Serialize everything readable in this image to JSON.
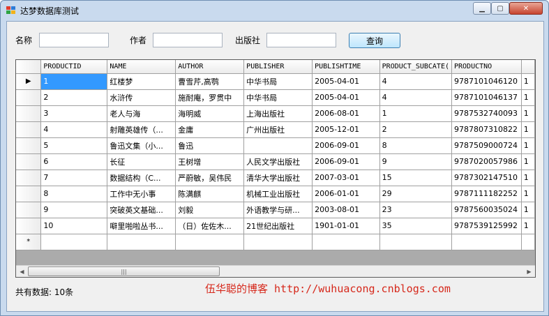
{
  "window": {
    "title": "达梦数据库测试",
    "minimize_glyph": "▁",
    "maximize_glyph": "▢",
    "close_glyph": "✕"
  },
  "filters": {
    "name_label": "名称",
    "name_value": "",
    "author_label": "作者",
    "author_value": "",
    "publisher_label": "出版社",
    "publisher_value": "",
    "query_button": "查询"
  },
  "grid": {
    "columns": [
      "PRODUCTID",
      "NAME",
      "AUTHOR",
      "PUBLISHER",
      "PUBLISHTIME",
      "PRODUCT_SUBCATE(",
      "PRODUCTNO",
      ""
    ],
    "current_row_glyph": "▶",
    "new_row_glyph": "*",
    "rows": [
      [
        "1",
        "红楼梦",
        "曹雪芹,高鹗",
        "中华书局",
        "2005-04-01",
        "4",
        "9787101046120",
        "1"
      ],
      [
        "2",
        "水浒传",
        "施耐庵，罗贯中",
        "中华书局",
        "2005-04-01",
        "4",
        "9787101046137",
        "1"
      ],
      [
        "3",
        "老人与海",
        "海明威",
        "上海出版社",
        "2006-08-01",
        "1",
        "9787532740093",
        "1"
      ],
      [
        "4",
        "射雕英雄传（...",
        "金庸",
        "广州出版社",
        "2005-12-01",
        "2",
        "9787807310822",
        "1"
      ],
      [
        "5",
        "鲁迅文集（小...",
        "鲁迅",
        "",
        "2006-09-01",
        "8",
        "9787509000724",
        "1"
      ],
      [
        "6",
        "长征",
        "王树增",
        "人民文学出版社",
        "2006-09-01",
        "9",
        "9787020057986",
        "1"
      ],
      [
        "7",
        "数据结构（C...",
        "严蔚敏，吴伟民",
        "清华大学出版社",
        "2007-03-01",
        "15",
        "9787302147510",
        "1"
      ],
      [
        "8",
        "工作中无小事",
        "陈满麒",
        "机械工业出版社",
        "2006-01-01",
        "29",
        "9787111182252",
        "1"
      ],
      [
        "9",
        "突破英文基础...",
        "刘毅",
        "外语教学与研...",
        "2003-08-01",
        "23",
        "9787560035024",
        "1"
      ],
      [
        "10",
        "噼里啪啦丛书...",
        "（日）佐佐木...",
        "21世纪出版社",
        "1901-01-01",
        "35",
        "9787539125992",
        "1"
      ]
    ],
    "scroll_left_glyph": "◀",
    "scroll_right_glyph": "▶",
    "scroll_thumb_glyph": "|||"
  },
  "status": {
    "count_text": "共有数据: 10条"
  },
  "watermark": {
    "text": "伍华聪的博客 http://wuhuacong.cnblogs.com"
  },
  "colors": {
    "selection": "#3399ff",
    "watermark": "#d6281b",
    "title_bg": "#c9daee"
  }
}
